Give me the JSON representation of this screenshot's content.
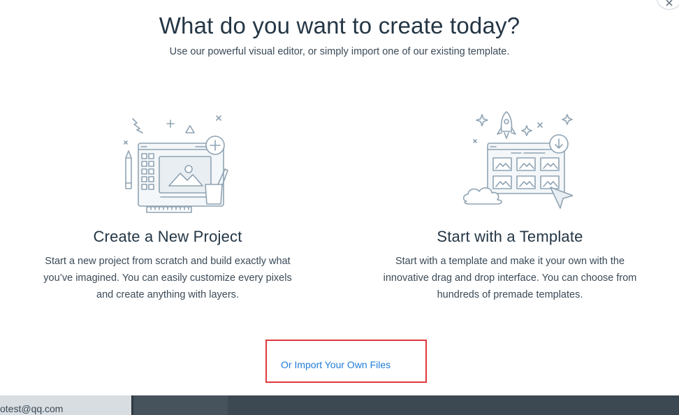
{
  "dialog": {
    "title": "What do you want to create today?",
    "subtitle": "Use our powerful visual editor, or simply import one of our existing template."
  },
  "options": [
    {
      "title": "Create a New Project",
      "description": "Start a new project from scratch and build exactly what you’ve imagined. You can easily customize every pixels and create anything with layers.",
      "icon": "editor-illustration-icon"
    },
    {
      "title": "Start with a Template",
      "description": "Start with a template and make it your own with the innovative drag and drop interface. You can choose from hundreds of premade templates.",
      "icon": "template-illustration-icon"
    }
  ],
  "import": {
    "label": "Or Import Your Own Files"
  },
  "footer": {
    "email": "otest@qq.com"
  },
  "colors": {
    "accent": "#1f7cd8",
    "highlight_border": "#e0383e",
    "text_dark": "#243645",
    "illustration_stroke": "#8fa3b3",
    "footer_bg": "#3c4852"
  }
}
